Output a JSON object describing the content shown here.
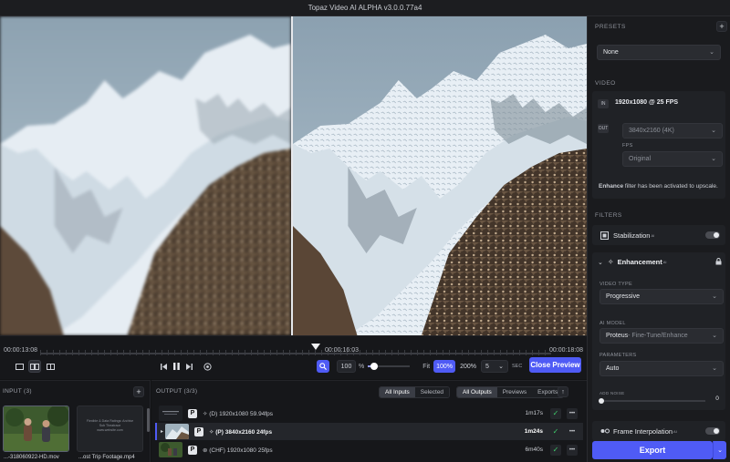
{
  "window": {
    "title": "Topaz Video AI ALPHA  v3.0.0.77a4"
  },
  "timeline": {
    "start_tc": "00:00:13:08",
    "current_tc": "00:00:16:03",
    "end_tc": "00:00:18:08",
    "playhead_fraction": 0.54
  },
  "view_controls": {
    "zoom_value": "100",
    "zoom_unit": "%",
    "zoom_fraction": 0.15,
    "fit_label": "Fit",
    "preset_100": "100%",
    "preset_200": "200%",
    "frames_value": "5",
    "frames_unit": "SEC",
    "close_preview_label": "Close Preview"
  },
  "input": {
    "header": "INPUT (3)",
    "add_label": "+",
    "items": [
      {
        "label": "...-318060922-HD.mov"
      },
      {
        "label": "...ost Trip Footage.mp4",
        "thumb_text": "Flexible & Data Ratings: Archive\nSub Theatrace\nwww.website.com"
      }
    ]
  },
  "output": {
    "header": "OUTPUT (3/3)",
    "filters_a": [
      "All Inputs",
      "Selected"
    ],
    "filters_b": [
      "All Outputs",
      "Previews",
      "Exports"
    ],
    "export_icon": "↑",
    "rows": [
      {
        "badge": "P",
        "desc": "✧ (D)   1920x1080  59.94fps",
        "time": "1m17s",
        "selected": false
      },
      {
        "badge": "P",
        "desc": "✧ (P)   3840x2160  24fps",
        "time": "1m24s",
        "selected": true
      },
      {
        "badge": "P",
        "desc": "⊛ (CHF)   1920x1080  25fps",
        "time": "6m40s",
        "selected": false
      }
    ],
    "check_glyph": "✓",
    "more_glyph": "•••"
  },
  "sidebar": {
    "presets": {
      "header": "PRESETS",
      "add": "+",
      "value": "None"
    },
    "video": {
      "header": "VIDEO",
      "in_tag": "IN",
      "in_value": "1920x1080 @ 25 FPS",
      "out_tag": "OUT",
      "out_value": "3840x2160 (4K)",
      "fps_label": "FPS",
      "fps_value": "Original",
      "note_bold": "Enhance",
      "note_rest": " filter has been activated to upscale."
    },
    "filters": {
      "header": "FILTERS",
      "stabilization": {
        "label": "Stabilization",
        "sup": "AI"
      },
      "enhancement": {
        "label": "Enhancement",
        "sup": "AI",
        "video_type_label": "VIDEO TYPE",
        "video_type_value": "Progressive",
        "ai_model_label": "AI MODEL",
        "ai_model_value": "Proteus",
        "ai_model_suffix": " - Fine-Tune/Enhance",
        "parameters_label": "PARAMETERS",
        "parameters_value": "Auto",
        "add_noise_label": "ADD NOISE",
        "add_noise_value": "0"
      },
      "frame_interpolation": {
        "label": "Frame Interpolation",
        "sup": "AI"
      }
    },
    "export_label": "Export"
  },
  "colors": {
    "accent": "#4f5bf5",
    "check": "#3fce6b"
  }
}
